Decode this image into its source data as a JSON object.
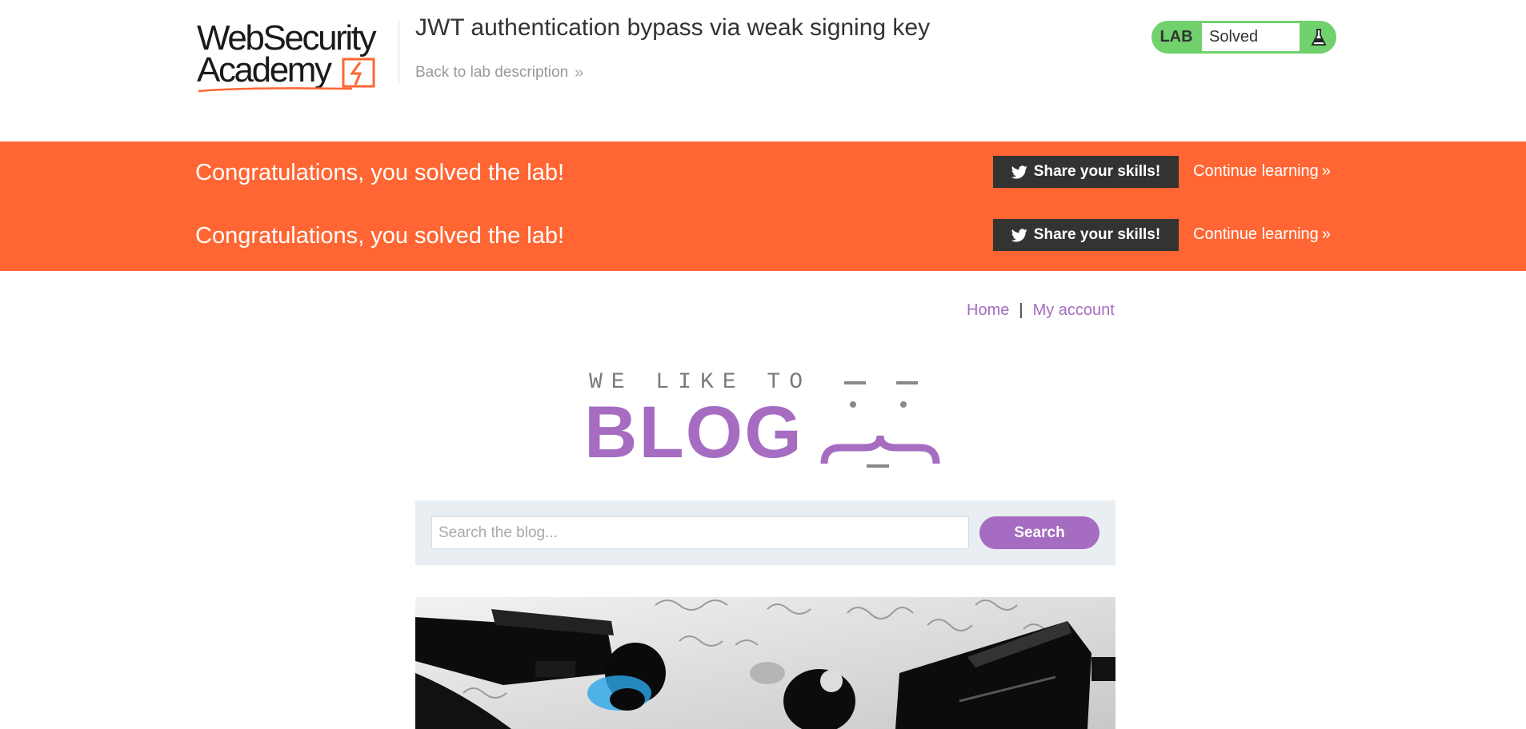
{
  "header": {
    "logo_line1": "WebSecurity",
    "logo_line2": "Academy",
    "lab_title": "JWT authentication bypass via weak signing key",
    "back_link": "Back to lab description",
    "back_chevron": "»"
  },
  "lab_status": {
    "tag": "LAB",
    "status": "Solved",
    "icon": "flask-icon"
  },
  "banner": {
    "rows": [
      {
        "message": "Congratulations, you solved the lab!",
        "share_label": "Share your skills!",
        "continue_label": "Continue learning",
        "chevron": "»"
      },
      {
        "message": "Congratulations, you solved the lab!",
        "share_label": "Share your skills!",
        "continue_label": "Continue learning",
        "chevron": "»"
      }
    ]
  },
  "nav": {
    "home": "Home",
    "separator": "|",
    "account": "My account"
  },
  "blog_logo": {
    "tagline": "WE LIKE TO",
    "word": "BLOG"
  },
  "search": {
    "placeholder": "Search the blog...",
    "value": "",
    "button_label": "Search"
  },
  "colors": {
    "accent_orange": "#ff6633",
    "brand_purple": "#a56cc1",
    "lab_green": "#70d16d",
    "dark_button": "#333332"
  }
}
